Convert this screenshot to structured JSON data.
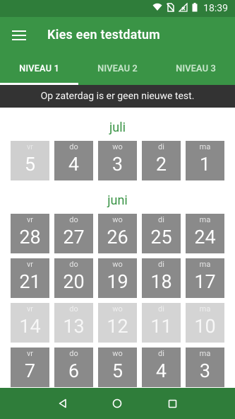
{
  "status_bar": {
    "time": "18:39"
  },
  "app_bar": {
    "title": "Kies een testdatum"
  },
  "tabs": [
    {
      "label": "NIVEAU 1",
      "active": true
    },
    {
      "label": "NIVEAU 2",
      "active": false
    },
    {
      "label": "NIVEAU 3",
      "active": false
    }
  ],
  "notice": "Op zaterdag is er geen nieuwe test.",
  "months": [
    {
      "name": "juli",
      "rows": [
        [
          {
            "dn": "vr",
            "num": "5",
            "state": "faded"
          },
          {
            "dn": "do",
            "num": "4",
            "state": "normal"
          },
          {
            "dn": "wo",
            "num": "3",
            "state": "normal"
          },
          {
            "dn": "di",
            "num": "2",
            "state": "normal"
          },
          {
            "dn": "ma",
            "num": "1",
            "state": "normal"
          }
        ]
      ]
    },
    {
      "name": "juni",
      "rows": [
        [
          {
            "dn": "vr",
            "num": "28",
            "state": "normal"
          },
          {
            "dn": "do",
            "num": "27",
            "state": "normal"
          },
          {
            "dn": "wo",
            "num": "26",
            "state": "normal"
          },
          {
            "dn": "di",
            "num": "25",
            "state": "normal"
          },
          {
            "dn": "ma",
            "num": "24",
            "state": "normal"
          }
        ],
        [
          {
            "dn": "vr",
            "num": "21",
            "state": "normal"
          },
          {
            "dn": "do",
            "num": "20",
            "state": "normal"
          },
          {
            "dn": "wo",
            "num": "19",
            "state": "normal"
          },
          {
            "dn": "di",
            "num": "18",
            "state": "normal"
          },
          {
            "dn": "ma",
            "num": "17",
            "state": "normal"
          }
        ],
        [
          {
            "dn": "vr",
            "num": "14",
            "state": "dim"
          },
          {
            "dn": "do",
            "num": "13",
            "state": "dim"
          },
          {
            "dn": "wo",
            "num": "12",
            "state": "dim"
          },
          {
            "dn": "di",
            "num": "11",
            "state": "dim"
          },
          {
            "dn": "ma",
            "num": "10",
            "state": "dim"
          }
        ],
        [
          {
            "dn": "vr",
            "num": "7",
            "state": "normal"
          },
          {
            "dn": "do",
            "num": "6",
            "state": "normal"
          },
          {
            "dn": "wo",
            "num": "5",
            "state": "normal"
          },
          {
            "dn": "di",
            "num": "4",
            "state": "normal"
          },
          {
            "dn": "ma",
            "num": "3",
            "state": "normal"
          }
        ]
      ]
    }
  ],
  "colors": {
    "primary": "#3a9446",
    "primary_dark": "#2f7d3a",
    "tile": "#8a8a8a",
    "tile_dim": "#d4d4d4",
    "notice_bg": "#333333"
  },
  "nav_icons": [
    "back-icon",
    "home-icon",
    "recents-icon"
  ]
}
